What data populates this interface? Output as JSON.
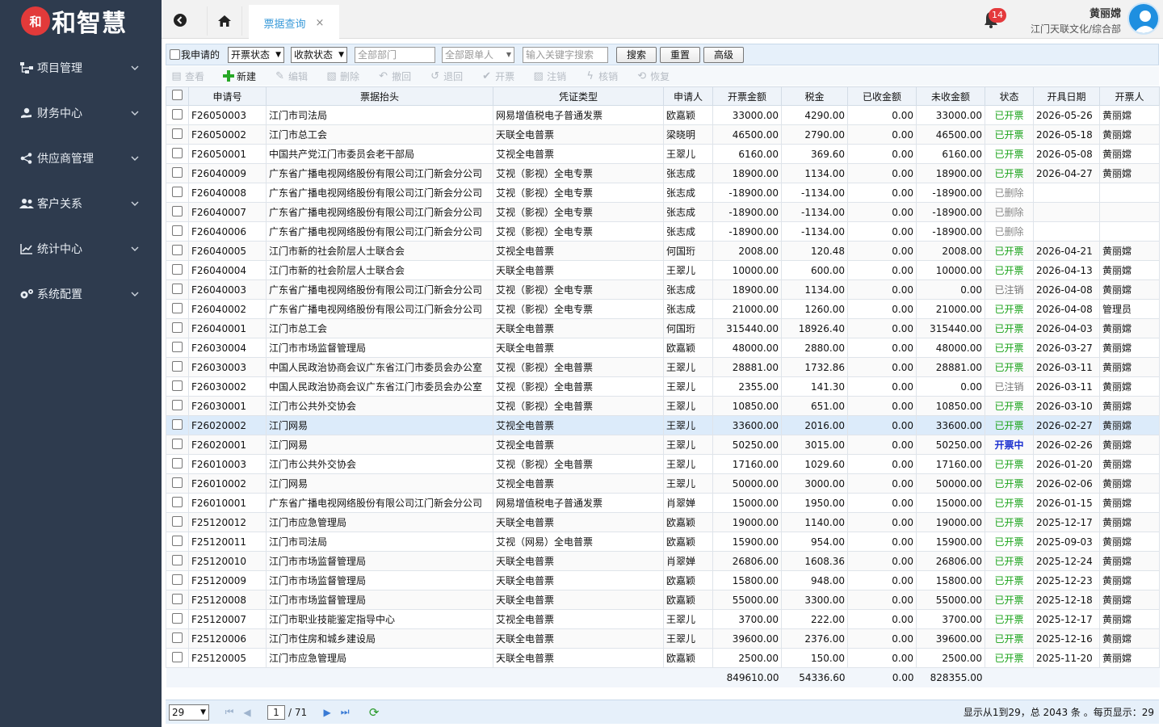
{
  "app": {
    "logo_text": "和智慧",
    "logo_mark": "和"
  },
  "sidebar": {
    "items": [
      {
        "label": "项目管理",
        "icon": "sitemap-icon"
      },
      {
        "label": "财务中心",
        "icon": "money-icon"
      },
      {
        "label": "供应商管理",
        "icon": "share-icon"
      },
      {
        "label": "客户关系",
        "icon": "users-icon"
      },
      {
        "label": "统计中心",
        "icon": "chart-icon"
      },
      {
        "label": "系统配置",
        "icon": "cogs-icon"
      }
    ]
  },
  "topbar": {
    "tab_label": "票据查询",
    "tab_close": "×",
    "notification_count": "14",
    "user_name": "黄丽嫦",
    "user_org": "江门天联文化/综合部"
  },
  "filters": {
    "mine_label": "我申请的",
    "invoice_status": "开票状态",
    "payment_status": "收款状态",
    "department_placeholder": "全部部门",
    "follower_placeholder": "全部跟单人",
    "keyword_placeholder": "输入关键字搜索",
    "search": "搜索",
    "reset": "重置",
    "advanced": "高级"
  },
  "toolbar": {
    "view": "查看",
    "new": "新建",
    "edit": "编辑",
    "delete": "删除",
    "withdraw": "撤回",
    "return": "退回",
    "issue": "开票",
    "void": "注销",
    "verify": "核销",
    "restore": "恢复"
  },
  "table": {
    "columns": [
      "申请号",
      "票据抬头",
      "凭证类型",
      "申请人",
      "开票金额",
      "税金",
      "已收金额",
      "未收金额",
      "状态",
      "开具日期",
      "开票人"
    ],
    "rows": [
      [
        "F26050003",
        "江门市司法局",
        "网易增值税电子普通发票",
        "欧嘉颖",
        "33000.00",
        "4290.00",
        "0.00",
        "33000.00",
        "已开票",
        "2026-05-26",
        "黄丽嫦"
      ],
      [
        "F26050002",
        "江门市总工会",
        "天联全电普票",
        "梁晓明",
        "46500.00",
        "2790.00",
        "0.00",
        "46500.00",
        "已开票",
        "2026-05-18",
        "黄丽嫦"
      ],
      [
        "F26050001",
        "中国共产党江门市委员会老干部局",
        "艾视全电普票",
        "王翠儿",
        "6160.00",
        "369.60",
        "0.00",
        "6160.00",
        "已开票",
        "2026-05-08",
        "黄丽嫦"
      ],
      [
        "F26040009",
        "广东省广播电视网络股份有限公司江门新会分公司",
        "艾视（影视）全电专票",
        "张志成",
        "18900.00",
        "1134.00",
        "0.00",
        "18900.00",
        "已开票",
        "2026-04-27",
        "黄丽嫦"
      ],
      [
        "F26040008",
        "广东省广播电视网络股份有限公司江门新会分公司",
        "艾视（影视）全电专票",
        "张志成",
        "-18900.00",
        "-1134.00",
        "0.00",
        "-18900.00",
        "已删除",
        "",
        ""
      ],
      [
        "F26040007",
        "广东省广播电视网络股份有限公司江门新会分公司",
        "艾视（影视）全电专票",
        "张志成",
        "-18900.00",
        "-1134.00",
        "0.00",
        "-18900.00",
        "已删除",
        "",
        ""
      ],
      [
        "F26040006",
        "广东省广播电视网络股份有限公司江门新会分公司",
        "艾视（影视）全电专票",
        "张志成",
        "-18900.00",
        "-1134.00",
        "0.00",
        "-18900.00",
        "已删除",
        "",
        ""
      ],
      [
        "F26040005",
        "江门市新的社会阶层人士联合会",
        "艾视全电普票",
        "何国珩",
        "2008.00",
        "120.48",
        "0.00",
        "2008.00",
        "已开票",
        "2026-04-21",
        "黄丽嫦"
      ],
      [
        "F26040004",
        "江门市新的社会阶层人士联合会",
        "天联全电普票",
        "王翠儿",
        "10000.00",
        "600.00",
        "0.00",
        "10000.00",
        "已开票",
        "2026-04-13",
        "黄丽嫦"
      ],
      [
        "F26040003",
        "广东省广播电视网络股份有限公司江门新会分公司",
        "艾视（影视）全电专票",
        "张志成",
        "18900.00",
        "1134.00",
        "0.00",
        "0.00",
        "已注销",
        "2026-04-08",
        "黄丽嫦"
      ],
      [
        "F26040002",
        "广东省广播电视网络股份有限公司江门新会分公司",
        "艾视（影视）全电专票",
        "张志成",
        "21000.00",
        "1260.00",
        "0.00",
        "21000.00",
        "已开票",
        "2026-04-08",
        "管理员"
      ],
      [
        "F26040001",
        "江门市总工会",
        "天联全电普票",
        "何国珩",
        "315440.00",
        "18926.40",
        "0.00",
        "315440.00",
        "已开票",
        "2026-04-03",
        "黄丽嫦"
      ],
      [
        "F26030004",
        "江门市市场监督管理局",
        "天联全电普票",
        "欧嘉颖",
        "48000.00",
        "2880.00",
        "0.00",
        "48000.00",
        "已开票",
        "2026-03-27",
        "黄丽嫦"
      ],
      [
        "F26030003",
        "中国人民政治协商会议广东省江门市委员会办公室",
        "艾视（影视）全电普票",
        "王翠儿",
        "28881.00",
        "1732.86",
        "0.00",
        "28881.00",
        "已开票",
        "2026-03-11",
        "黄丽嫦"
      ],
      [
        "F26030002",
        "中国人民政治协商会议广东省江门市委员会办公室",
        "艾视（影视）全电普票",
        "王翠儿",
        "2355.00",
        "141.30",
        "0.00",
        "0.00",
        "已注销",
        "2026-03-11",
        "黄丽嫦"
      ],
      [
        "F26030001",
        "江门市公共外交协会",
        "艾视（影视）全电普票",
        "王翠儿",
        "10850.00",
        "651.00",
        "0.00",
        "10850.00",
        "已开票",
        "2026-03-10",
        "黄丽嫦"
      ],
      [
        "F26020002",
        "江门网易",
        "艾视全电普票",
        "王翠儿",
        "33600.00",
        "2016.00",
        "0.00",
        "33600.00",
        "已开票",
        "2026-02-27",
        "黄丽嫦"
      ],
      [
        "F26020001",
        "江门网易",
        "艾视全电普票",
        "王翠儿",
        "50250.00",
        "3015.00",
        "0.00",
        "50250.00",
        "开票中",
        "2026-02-26",
        "黄丽嫦"
      ],
      [
        "F26010003",
        "江门市公共外交协会",
        "艾视（影视）全电普票",
        "王翠儿",
        "17160.00",
        "1029.60",
        "0.00",
        "17160.00",
        "已开票",
        "2026-01-20",
        "黄丽嫦"
      ],
      [
        "F26010002",
        "江门网易",
        "艾视全电普票",
        "王翠儿",
        "50000.00",
        "3000.00",
        "0.00",
        "50000.00",
        "已开票",
        "2026-02-06",
        "黄丽嫦"
      ],
      [
        "F26010001",
        "广东省广播电视网络股份有限公司江门新会分公司",
        "网易增值税电子普通发票",
        "肖翠婵",
        "15000.00",
        "1950.00",
        "0.00",
        "15000.00",
        "已开票",
        "2026-01-15",
        "黄丽嫦"
      ],
      [
        "F25120012",
        "江门市应急管理局",
        "天联全电普票",
        "欧嘉颖",
        "19000.00",
        "1140.00",
        "0.00",
        "19000.00",
        "已开票",
        "2025-12-17",
        "黄丽嫦"
      ],
      [
        "F25120011",
        "江门市司法局",
        "艾视（网易）全电普票",
        "欧嘉颖",
        "15900.00",
        "954.00",
        "0.00",
        "15900.00",
        "已开票",
        "2025-09-03",
        "黄丽嫦"
      ],
      [
        "F25120010",
        "江门市市场监督管理局",
        "天联全电普票",
        "肖翠婵",
        "26806.00",
        "1608.36",
        "0.00",
        "26806.00",
        "已开票",
        "2025-12-24",
        "黄丽嫦"
      ],
      [
        "F25120009",
        "江门市市场监督管理局",
        "天联全电普票",
        "欧嘉颖",
        "15800.00",
        "948.00",
        "0.00",
        "15800.00",
        "已开票",
        "2025-12-23",
        "黄丽嫦"
      ],
      [
        "F25120008",
        "江门市市场监督管理局",
        "天联全电普票",
        "欧嘉颖",
        "55000.00",
        "3300.00",
        "0.00",
        "55000.00",
        "已开票",
        "2025-12-18",
        "黄丽嫦"
      ],
      [
        "F25120007",
        "江门市职业技能鉴定指导中心",
        "艾视全电普票",
        "王翠儿",
        "3700.00",
        "222.00",
        "0.00",
        "3700.00",
        "已开票",
        "2025-12-17",
        "黄丽嫦"
      ],
      [
        "F25120006",
        "江门市住房和城乡建设局",
        "天联全电普票",
        "王翠儿",
        "39600.00",
        "2376.00",
        "0.00",
        "39600.00",
        "已开票",
        "2025-12-16",
        "黄丽嫦"
      ],
      [
        "F25120005",
        "江门市应急管理局",
        "天联全电普票",
        "欧嘉颖",
        "2500.00",
        "150.00",
        "0.00",
        "2500.00",
        "已开票",
        "2025-11-20",
        "黄丽嫦"
      ]
    ],
    "totals": {
      "amount": "849610.00",
      "tax": "54336.60",
      "received": "0.00",
      "unreceived": "828355.00"
    }
  },
  "pager": {
    "page_size": "29",
    "current_page": "1",
    "total_pages": "/ 71",
    "info": "显示从1到29，总 2043 条 。每页显示：29"
  },
  "colors": {
    "sidebar_bg": "#2e3b4e",
    "accent": "#3a9ad9",
    "status_ok": "#1aa31a",
    "status_pending": "#1a2fd0",
    "badge": "#e4393c"
  }
}
